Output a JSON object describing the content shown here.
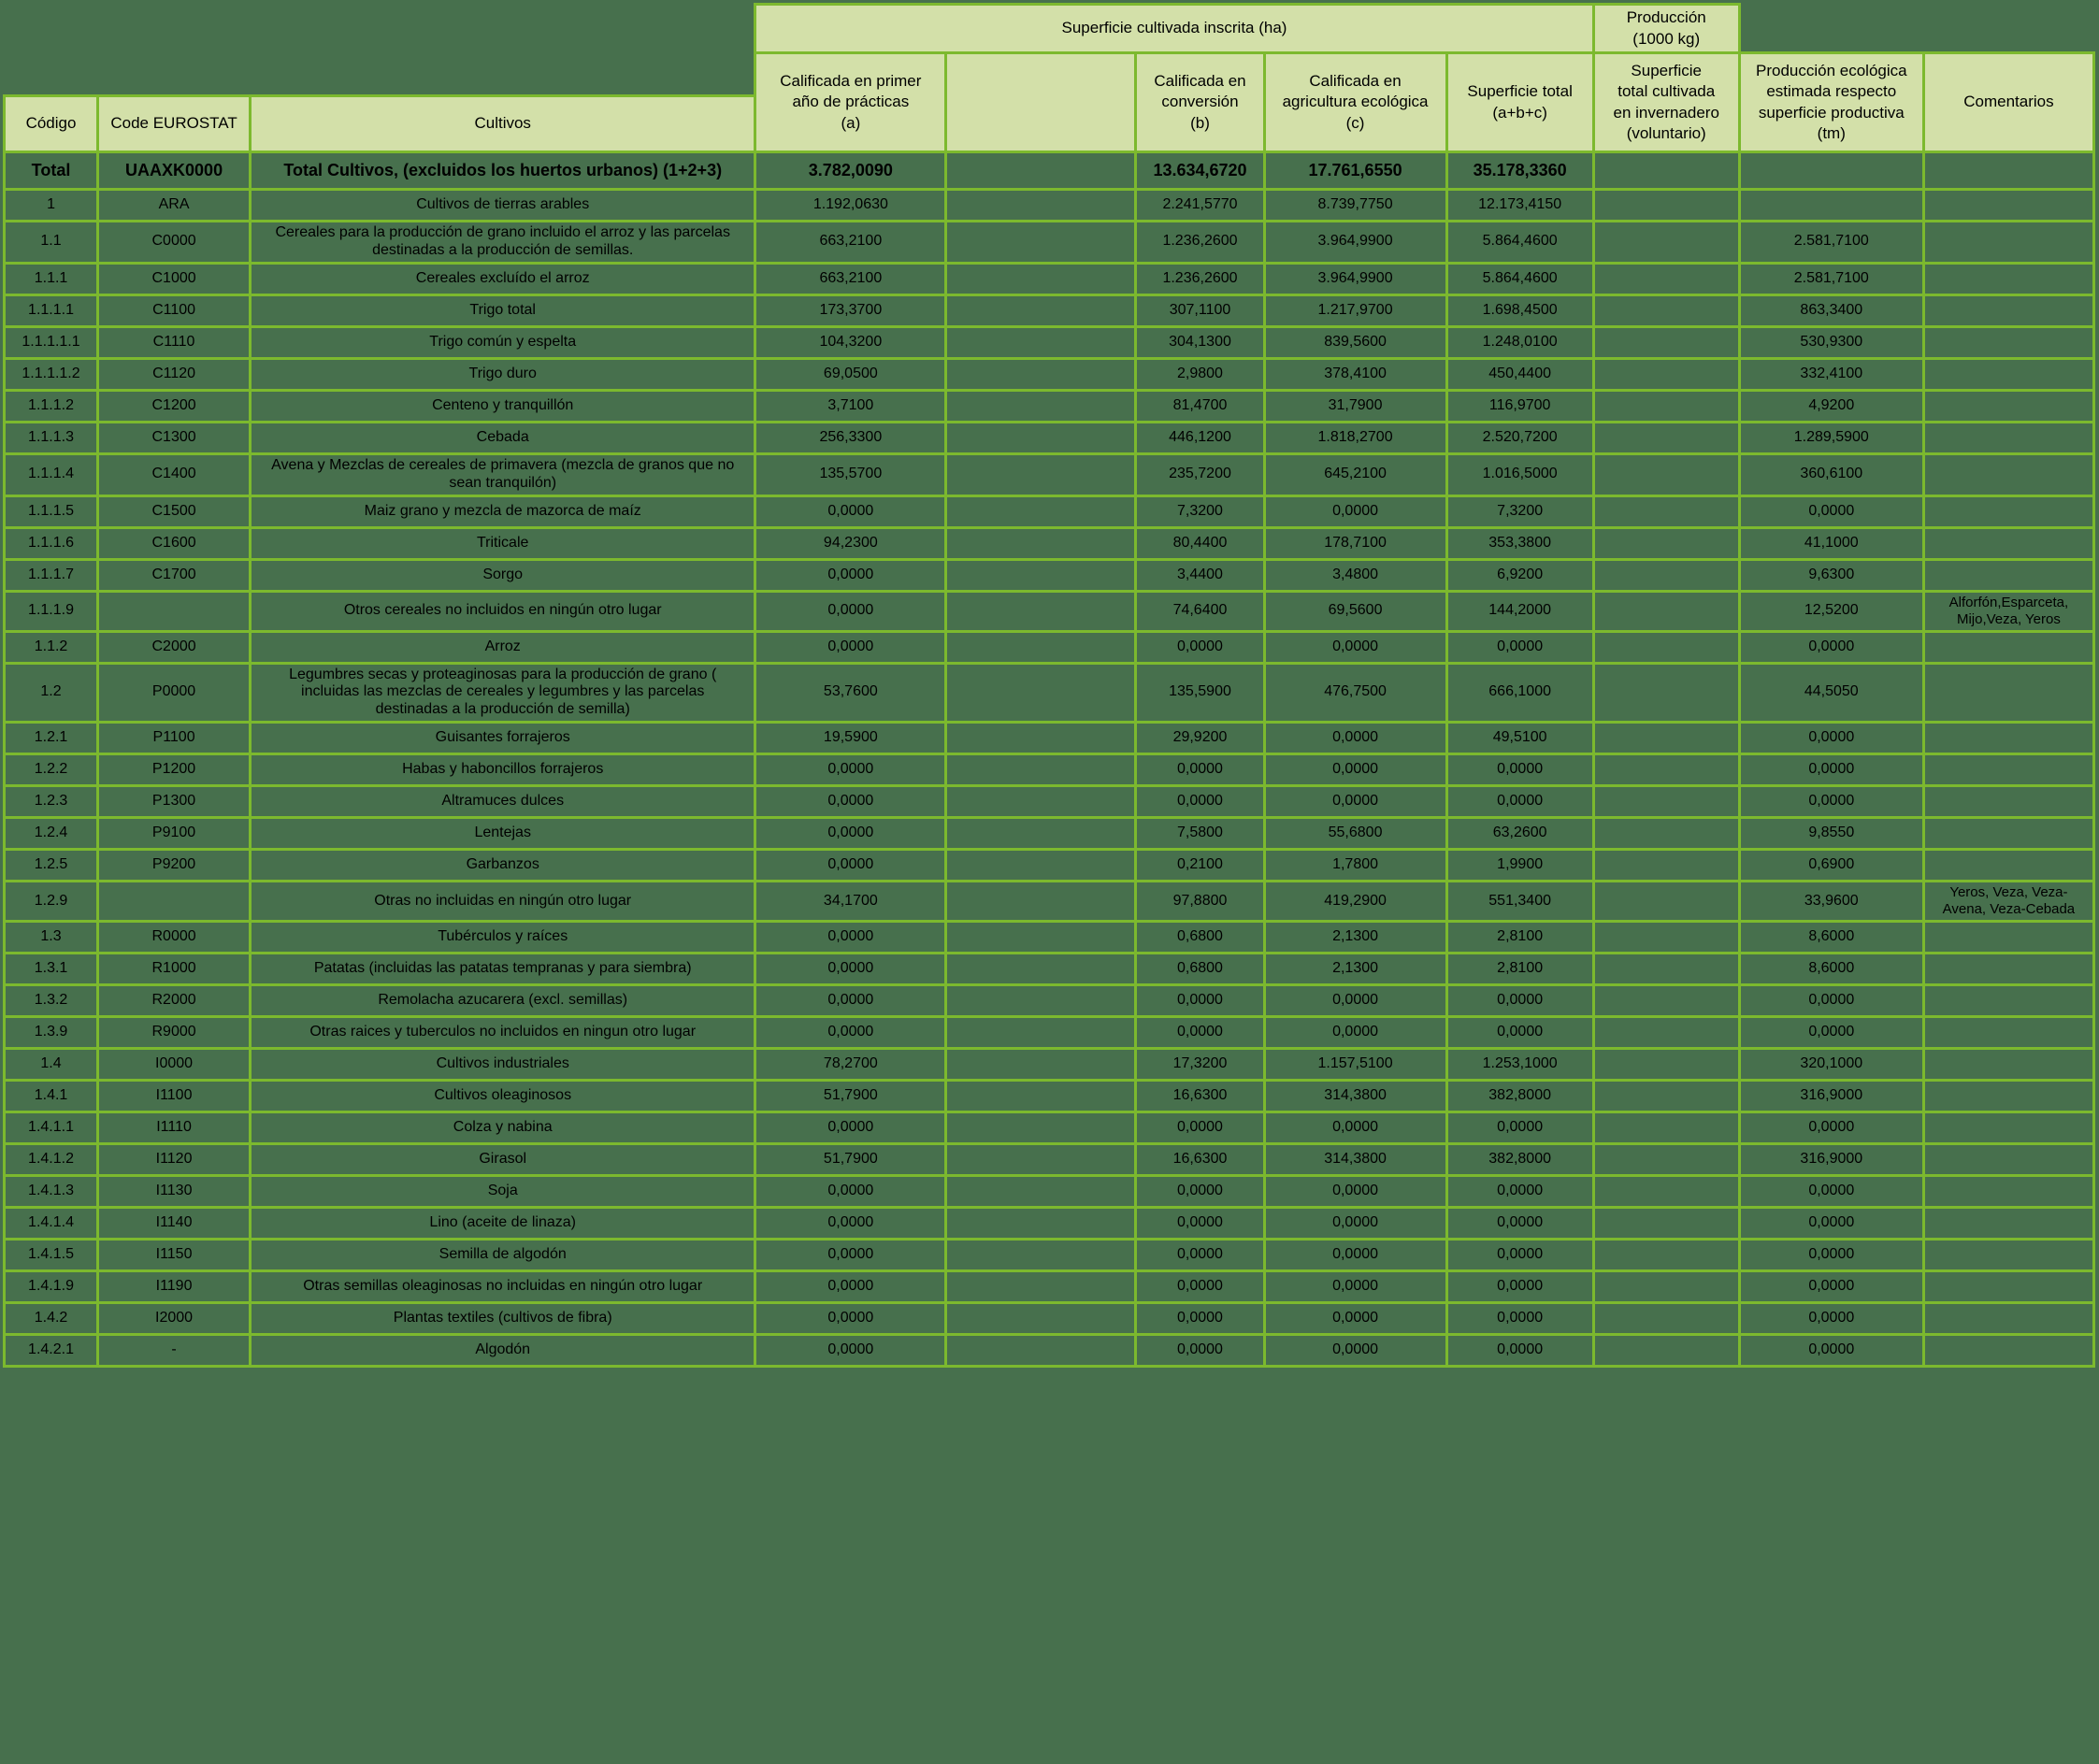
{
  "page": {
    "background_color": "#47704D",
    "grid_color": "#7CB92E",
    "header_cell_color": "#D3E0A9",
    "text_color": "#000000"
  },
  "header": {
    "group_superficie": "Superficie cultivada inscrita (ha)",
    "group_produccion": "Producción\n(1000 kg)",
    "columns": {
      "codigo": "Código",
      "code_eurostat": "Code EUROSTAT",
      "cultivos": "Cultivos",
      "col_a": "Calificada en primer\naño de prácticas\n(a)",
      "col_gap": "",
      "col_b": "Calificada en\nconversión\n(b)",
      "col_c": "Calificada en\nagricultura ecológica\n(c)",
      "col_total": "Superficie total\n(a+b+c)",
      "col_invernadero": "Superficie\ntotal cultivada\nen invernadero\n(voluntario)",
      "col_produccion": "Producción ecológica\nestimada respecto\nsuperficie productiva\n(tm)",
      "col_comentarios": "Comentarios"
    }
  },
  "rows": [
    {
      "total": true,
      "codigo": "Total",
      "code": "UAAXK0000",
      "cultivos": "Total Cultivos, (excluidos los huertos urbanos) (1+2+3)",
      "a": "3.782,0090",
      "b": "13.634,6720",
      "c": "17.761,6550",
      "suma": "35.178,3360",
      "invernadero": "",
      "produccion": "",
      "comentarios": ""
    },
    {
      "codigo": "1",
      "code": "ARA",
      "cultivos": "Cultivos de tierras arables",
      "a": "1.192,0630",
      "b": "2.241,5770",
      "c": "8.739,7750",
      "suma": "12.173,4150",
      "invernadero": "",
      "produccion": "",
      "comentarios": ""
    },
    {
      "codigo": "1.1",
      "code": "C0000",
      "cultivos": "Cereales para la producción de grano incluido el arroz y las parcelas destinadas a la producción de semillas.",
      "a": "663,2100",
      "b": "1.236,2600",
      "c": "3.964,9900",
      "suma": "5.864,4600",
      "invernadero": "",
      "produccion": "2.581,7100",
      "comentarios": ""
    },
    {
      "codigo": "1.1.1",
      "code": "C1000",
      "cultivos": "Cereales excluído el arroz",
      "a": "663,2100",
      "b": "1.236,2600",
      "c": "3.964,9900",
      "suma": "5.864,4600",
      "invernadero": "",
      "produccion": "2.581,7100",
      "comentarios": ""
    },
    {
      "codigo": "1.1.1.1",
      "code": "C1100",
      "cultivos": "Trigo total",
      "a": "173,3700",
      "b": "307,1100",
      "c": "1.217,9700",
      "suma": "1.698,4500",
      "invernadero": "",
      "produccion": "863,3400",
      "comentarios": ""
    },
    {
      "codigo": "1.1.1.1.1",
      "code": "C1110",
      "cultivos": "Trigo común y espelta",
      "a": "104,3200",
      "b": "304,1300",
      "c": "839,5600",
      "suma": "1.248,0100",
      "invernadero": "",
      "produccion": "530,9300",
      "comentarios": ""
    },
    {
      "codigo": "1.1.1.1.2",
      "code": "C1120",
      "cultivos": "Trigo duro",
      "a": "69,0500",
      "b": "2,9800",
      "c": "378,4100",
      "suma": "450,4400",
      "invernadero": "",
      "produccion": "332,4100",
      "comentarios": ""
    },
    {
      "codigo": "1.1.1.2",
      "code": "C1200",
      "cultivos": "Centeno y tranquillón",
      "a": "3,7100",
      "b": "81,4700",
      "c": "31,7900",
      "suma": "116,9700",
      "invernadero": "",
      "produccion": "4,9200",
      "comentarios": ""
    },
    {
      "codigo": "1.1.1.3",
      "code": "C1300",
      "cultivos": "Cebada",
      "a": "256,3300",
      "b": "446,1200",
      "c": "1.818,2700",
      "suma": "2.520,7200",
      "invernadero": "",
      "produccion": "1.289,5900",
      "comentarios": ""
    },
    {
      "codigo": "1.1.1.4",
      "code": "C1400",
      "cultivos": "Avena y Mezclas de cereales de primavera (mezcla de granos que no sean tranquilón)",
      "a": "135,5700",
      "b": "235,7200",
      "c": "645,2100",
      "suma": "1.016,5000",
      "invernadero": "",
      "produccion": "360,6100",
      "comentarios": ""
    },
    {
      "codigo": "1.1.1.5",
      "code": "C1500",
      "cultivos": "Maiz grano y mezcla de mazorca de maíz",
      "a": "0,0000",
      "b": "7,3200",
      "c": "0,0000",
      "suma": "7,3200",
      "invernadero": "",
      "produccion": "0,0000",
      "comentarios": ""
    },
    {
      "codigo": "1.1.1.6",
      "code": "C1600",
      "cultivos": "Triticale",
      "a": "94,2300",
      "b": "80,4400",
      "c": "178,7100",
      "suma": "353,3800",
      "invernadero": "",
      "produccion": "41,1000",
      "comentarios": ""
    },
    {
      "codigo": "1.1.1.7",
      "code": "C1700",
      "cultivos": "Sorgo",
      "a": "0,0000",
      "b": "3,4400",
      "c": "3,4800",
      "suma": "6,9200",
      "invernadero": "",
      "produccion": "9,6300",
      "comentarios": ""
    },
    {
      "codigo": "1.1.1.9",
      "code": "",
      "cultivos": "Otros cereales no incluidos en ningún otro lugar",
      "a": "0,0000",
      "b": "74,6400",
      "c": "69,5600",
      "suma": "144,2000",
      "invernadero": "",
      "produccion": "12,5200",
      "comentarios": "Alforfón,Esparceta, Mijo,Veza, Yeros"
    },
    {
      "codigo": "1.1.2",
      "code": "C2000",
      "cultivos": "Arroz",
      "a": "0,0000",
      "b": "0,0000",
      "c": "0,0000",
      "suma": "0,0000",
      "invernadero": "",
      "produccion": "0,0000",
      "comentarios": ""
    },
    {
      "codigo": "1.2",
      "code": "P0000",
      "cultivos": "Legumbres secas y proteaginosas para la producción de grano ( incluidas las mezclas de cereales y legumbres y las parcelas destinadas a la producción de semilla)",
      "a": "53,7600",
      "b": "135,5900",
      "c": "476,7500",
      "suma": "666,1000",
      "invernadero": "",
      "produccion": "44,5050",
      "comentarios": ""
    },
    {
      "codigo": "1.2.1",
      "code": "P1100",
      "cultivos": "Guisantes forrajeros",
      "a": "19,5900",
      "b": "29,9200",
      "c": "0,0000",
      "suma": "49,5100",
      "invernadero": "",
      "produccion": "0,0000",
      "comentarios": ""
    },
    {
      "codigo": "1.2.2",
      "code": "P1200",
      "cultivos": "Habas y haboncillos forrajeros",
      "a": "0,0000",
      "b": "0,0000",
      "c": "0,0000",
      "suma": "0,0000",
      "invernadero": "",
      "produccion": "0,0000",
      "comentarios": ""
    },
    {
      "codigo": "1.2.3",
      "code": "P1300",
      "cultivos": "Altramuces dulces",
      "a": "0,0000",
      "b": "0,0000",
      "c": "0,0000",
      "suma": "0,0000",
      "invernadero": "",
      "produccion": "0,0000",
      "comentarios": ""
    },
    {
      "codigo": "1.2.4",
      "code": "P9100",
      "cultivos": "Lentejas",
      "a": "0,0000",
      "b": "7,5800",
      "c": "55,6800",
      "suma": "63,2600",
      "invernadero": "",
      "produccion": "9,8550",
      "comentarios": ""
    },
    {
      "codigo": "1.2.5",
      "code": "P9200",
      "cultivos": "Garbanzos",
      "a": "0,0000",
      "b": "0,2100",
      "c": "1,7800",
      "suma": "1,9900",
      "invernadero": "",
      "produccion": "0,6900",
      "comentarios": ""
    },
    {
      "codigo": "1.2.9",
      "code": "",
      "cultivos": "Otras no incluidas en ningún otro lugar",
      "a": "34,1700",
      "b": "97,8800",
      "c": "419,2900",
      "suma": "551,3400",
      "invernadero": "",
      "produccion": "33,9600",
      "comentarios": "Yeros, Veza, Veza-Avena, Veza-Cebada"
    },
    {
      "codigo": "1.3",
      "code": "R0000",
      "cultivos": "Tubérculos y raíces",
      "a": "0,0000",
      "b": "0,6800",
      "c": "2,1300",
      "suma": "2,8100",
      "invernadero": "",
      "produccion": "8,6000",
      "comentarios": ""
    },
    {
      "codigo": "1.3.1",
      "code": "R1000",
      "cultivos": "Patatas (incluidas las patatas tempranas y para siembra)",
      "a": "0,0000",
      "b": "0,6800",
      "c": "2,1300",
      "suma": "2,8100",
      "invernadero": "",
      "produccion": "8,6000",
      "comentarios": ""
    },
    {
      "codigo": "1.3.2",
      "code": "R2000",
      "cultivos": "Remolacha azucarera (excl. semillas)",
      "a": "0,0000",
      "b": "0,0000",
      "c": "0,0000",
      "suma": "0,0000",
      "invernadero": "",
      "produccion": "0,0000",
      "comentarios": ""
    },
    {
      "codigo": "1.3.9",
      "code": "R9000",
      "cultivos": "Otras raices y tuberculos no incluidos en ningun otro lugar",
      "a": "0,0000",
      "b": "0,0000",
      "c": "0,0000",
      "suma": "0,0000",
      "invernadero": "",
      "produccion": "0,0000",
      "comentarios": ""
    },
    {
      "codigo": "1.4",
      "code": "I0000",
      "cultivos": "Cultivos industriales",
      "a": "78,2700",
      "b": "17,3200",
      "c": "1.157,5100",
      "suma": "1.253,1000",
      "invernadero": "",
      "produccion": "320,1000",
      "comentarios": ""
    },
    {
      "codigo": "1.4.1",
      "code": "I1100",
      "cultivos": "Cultivos oleaginosos",
      "a": "51,7900",
      "b": "16,6300",
      "c": "314,3800",
      "suma": "382,8000",
      "invernadero": "",
      "produccion": "316,9000",
      "comentarios": ""
    },
    {
      "codigo": "1.4.1.1",
      "code": "I1110",
      "cultivos": "Colza y nabina",
      "a": "0,0000",
      "b": "0,0000",
      "c": "0,0000",
      "suma": "0,0000",
      "invernadero": "",
      "produccion": "0,0000",
      "comentarios": ""
    },
    {
      "codigo": "1.4.1.2",
      "code": "I1120",
      "cultivos": "Girasol",
      "a": "51,7900",
      "b": "16,6300",
      "c": "314,3800",
      "suma": "382,8000",
      "invernadero": "",
      "produccion": "316,9000",
      "comentarios": ""
    },
    {
      "codigo": "1.4.1.3",
      "code": "I1130",
      "cultivos": "Soja",
      "a": "0,0000",
      "b": "0,0000",
      "c": "0,0000",
      "suma": "0,0000",
      "invernadero": "",
      "produccion": "0,0000",
      "comentarios": ""
    },
    {
      "codigo": "1.4.1.4",
      "code": "I1140",
      "cultivos": "Lino (aceite de linaza)",
      "a": "0,0000",
      "b": "0,0000",
      "c": "0,0000",
      "suma": "0,0000",
      "invernadero": "",
      "produccion": "0,0000",
      "comentarios": ""
    },
    {
      "codigo": "1.4.1.5",
      "code": "I1150",
      "cultivos": "Semilla de algodón",
      "a": "0,0000",
      "b": "0,0000",
      "c": "0,0000",
      "suma": "0,0000",
      "invernadero": "",
      "produccion": "0,0000",
      "comentarios": ""
    },
    {
      "codigo": "1.4.1.9",
      "code": "I1190",
      "cultivos": "Otras semillas oleaginosas no incluidas en ningún otro lugar",
      "a": "0,0000",
      "b": "0,0000",
      "c": "0,0000",
      "suma": "0,0000",
      "invernadero": "",
      "produccion": "0,0000",
      "comentarios": ""
    },
    {
      "codigo": "1.4.2",
      "code": "I2000",
      "cultivos": "Plantas textiles (cultivos de fibra)",
      "a": "0,0000",
      "b": "0,0000",
      "c": "0,0000",
      "suma": "0,0000",
      "invernadero": "",
      "produccion": "0,0000",
      "comentarios": ""
    },
    {
      "codigo": "1.4.2.1",
      "code": "-",
      "cultivos": "Algodón",
      "a": "0,0000",
      "b": "0,0000",
      "c": "0,0000",
      "suma": "0,0000",
      "invernadero": "",
      "produccion": "0,0000",
      "comentarios": ""
    }
  ]
}
